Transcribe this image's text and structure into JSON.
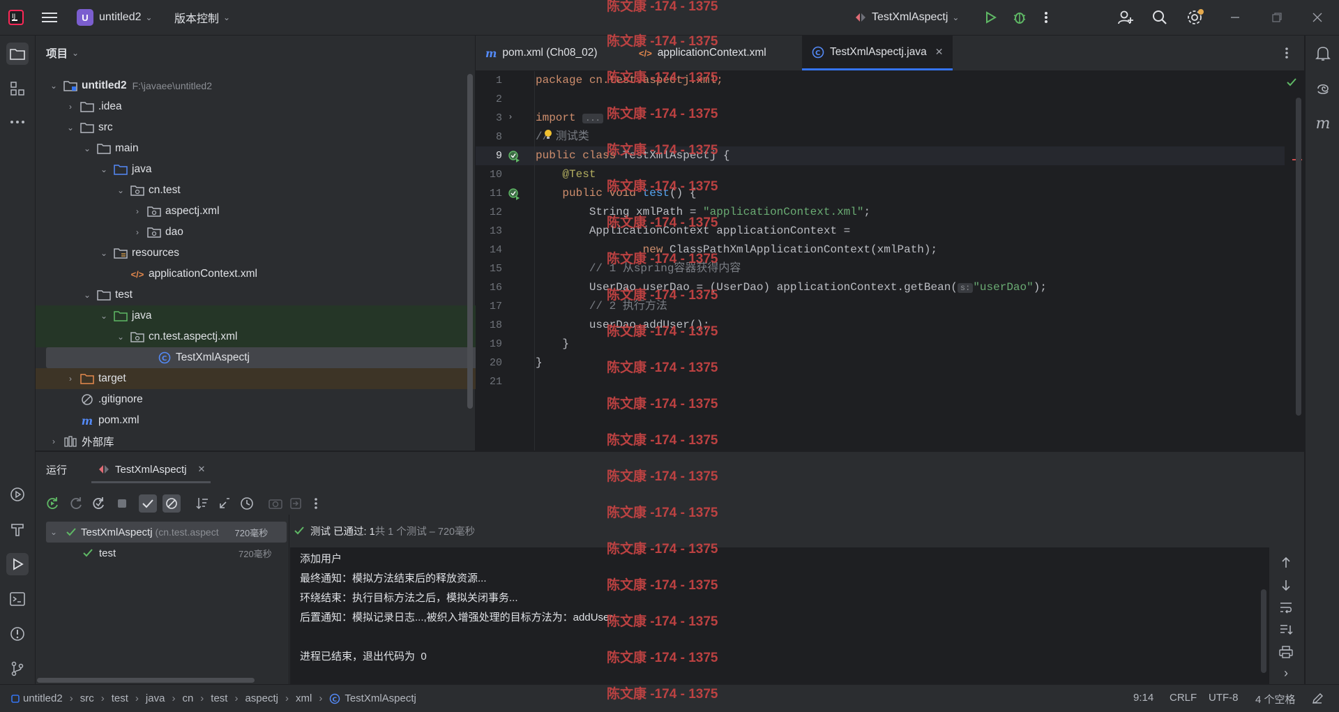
{
  "titlebar": {
    "project_initial": "U",
    "project_name": "untitled2",
    "vcs_menu": "版本控制",
    "run_config": "TestXmlAspectj"
  },
  "project_panel": {
    "title": "项目",
    "tree": [
      {
        "label": "untitled2",
        "hint": "F:\\javaee\\untitled2",
        "icon": "module-folder-icon",
        "bold": true
      },
      {
        "label": ".idea",
        "icon": "folder-icon"
      },
      {
        "label": "src",
        "icon": "folder-icon"
      },
      {
        "label": "main",
        "icon": "folder-icon"
      },
      {
        "label": "java",
        "icon": "source-root-icon"
      },
      {
        "label": "cn.test",
        "icon": "package-icon"
      },
      {
        "label": "aspectj.xml",
        "icon": "package-icon"
      },
      {
        "label": "dao",
        "icon": "package-icon"
      },
      {
        "label": "resources",
        "icon": "resources-folder-icon"
      },
      {
        "label": "applicationContext.xml",
        "icon": "xml-file-icon"
      },
      {
        "label": "test",
        "icon": "folder-icon"
      },
      {
        "label": "java",
        "icon": "test-root-icon"
      },
      {
        "label": "cn.test.aspectj.xml",
        "icon": "package-icon"
      },
      {
        "label": "TestXmlAspectj",
        "icon": "java-class-icon"
      },
      {
        "label": "target",
        "icon": "excluded-folder-icon"
      },
      {
        "label": ".gitignore",
        "icon": "ignored-file-icon"
      },
      {
        "label": "pom.xml",
        "icon": "maven-icon"
      },
      {
        "label": "外部库",
        "icon": "library-icon"
      }
    ]
  },
  "editor": {
    "tabs": [
      {
        "label": "pom.xml (Ch08_02)",
        "icon": "maven-icon"
      },
      {
        "label": "applicationContext.xml",
        "icon": "xml-file-icon"
      },
      {
        "label": "TestXmlAspectj.java",
        "icon": "java-class-icon",
        "active": true
      }
    ],
    "line_numbers": [
      "1",
      "2",
      "3",
      "8",
      "9",
      "10",
      "11",
      "12",
      "13",
      "14",
      "15",
      "16",
      "17",
      "18",
      "19",
      "20",
      "21"
    ],
    "code": {
      "l1": "package cn.test.aspectj.xml;",
      "l3a": "import ",
      "l3b": "...",
      "l8": "// 测试类",
      "l9a": "public class ",
      "l9b": "TestXmlAspectj {",
      "l10": "    @Test",
      "l11a": "    public void ",
      "l11b": "test",
      "l11c": "() {",
      "l12a": "        String xmlPath = ",
      "l12b": "\"applicationContext.xml\"",
      "l12c": ";",
      "l13": "        ApplicationContext applicationContext =",
      "l14a": "                ",
      "l14b": "new ",
      "l14c": "ClassPathXmlApplicationContext(xmlPath);",
      "l15": "        // 1 从spring容器获得内容",
      "l16a": "        UserDao userDao = (UserDao) applicationContext.getBean(",
      "l16hint": "s:",
      "l16b": "\"userDao\"",
      "l16c": ");",
      "l17": "        // 2 执行方法",
      "l18": "        userDao.addUser();",
      "l19": "    }",
      "l20": "}"
    }
  },
  "run_panel": {
    "title": "运行",
    "tab_label": "TestXmlAspectj",
    "tree": [
      {
        "label": "TestXmlAspectj",
        "hint": "(cn.test.aspect",
        "time": "720毫秒"
      },
      {
        "label": "test",
        "time": "720毫秒"
      }
    ],
    "status_pass": "测试 已通过: 1",
    "status_detail": "共 1 个测试 – 720毫秒",
    "console": [
      "添加用户",
      "最终通知：模拟方法结束后的释放资源...",
      "环绕结束：执行目标方法之后，模拟关闭事务...",
      "后置通知：模拟记录日志...,被织入增强处理的目标方法为：addUser",
      "",
      "进程已结束，退出代码为  0"
    ]
  },
  "statusbar": {
    "breadcrumbs": [
      "untitled2",
      "src",
      "test",
      "java",
      "cn",
      "test",
      "aspectj",
      "xml",
      "TestXmlAspectj"
    ],
    "position": "9:14",
    "line_sep": "CRLF",
    "encoding": "UTF-8",
    "indent": "4 个空格"
  },
  "watermark": "陈文康 -174 - 1375",
  "colors": {
    "accent": "#3574f0",
    "pass": "#5fb865",
    "watermark": "#c94444"
  }
}
